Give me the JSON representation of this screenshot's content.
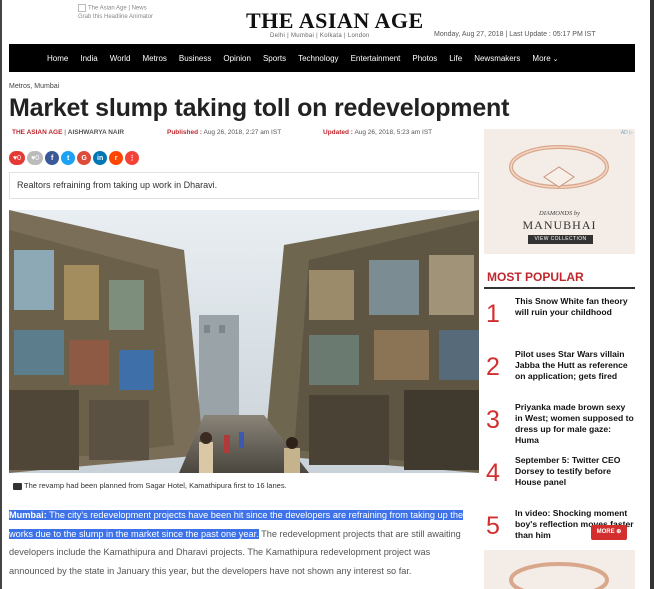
{
  "header": {
    "ad_thumb_text": "The Asian Age | News",
    "ad_thumb_sub": "Grab this Headline Animator",
    "logo": "THE ASIAN AGE",
    "logo_sub": "Delhi | Mumbai | Kolkata | London",
    "date": "Monday, Aug 27, 2018 | Last Update : 05:17 PM IST"
  },
  "nav": {
    "items": [
      "Home",
      "India",
      "World",
      "Metros",
      "Business",
      "Opinion",
      "Sports",
      "Technology",
      "Entertainment",
      "Photos",
      "Life",
      "Newsmakers",
      "More"
    ]
  },
  "article": {
    "breadcrumb": "Metros, Mumbai",
    "title": "Market slump taking toll on redevelopment",
    "source": "THE ASIAN AGE",
    "author": "AISHWARYA NAIR",
    "published_label": "Published :",
    "published": "Aug 26, 2018, 2:27 am IST",
    "updated_label": "Updated :",
    "updated": "Aug 26, 2018, 5:23 am IST",
    "likes": "0",
    "dislikes": "0",
    "subheading": "Realtors refraining from taking up work in Dharavi.",
    "caption": "The revamp had been planned from Sagar Hotel, Kamathipura first to 16 lanes.",
    "lead": "Mumbai:",
    "highlighted": " The city's redevelopment projects have been hit since the developers are refraining from taking up the works due to the slump in the market since the past one year.",
    "rest": " The redevelopment projects that are still awaiting developers include the Kamathipura and Dharavi projects. The Kamathipura redevelopment project was announced by the state in January this year, but the developers have not shown any interest so far."
  },
  "sidebar": {
    "ad": {
      "adchoices": "AD ▷",
      "line1": "DIAMONDS by",
      "line2": "MANUBHAI",
      "cta": "VIEW COLLECTION"
    },
    "most_popular_title": "MOST POPULAR",
    "items": [
      {
        "num": "1",
        "text": "This Snow White fan theory will ruin your childhood"
      },
      {
        "num": "2",
        "text": "Pilot uses Star Wars villain Jabba the Hutt as reference on application; gets fired"
      },
      {
        "num": "3",
        "text": "Priyanka made brown sexy in West; women supposed to dress up for male gaze: Huma"
      },
      {
        "num": "4",
        "text": "September 5: Twitter CEO Dorsey to testify before House panel"
      },
      {
        "num": "5",
        "text": "In video: Shocking moment boy's reflection moves faster than him"
      }
    ],
    "more_label": "MORE ⊕"
  },
  "colors": {
    "brand_red": "#c0272d",
    "nav_bg": "#000000",
    "highlight": "#3d72e8"
  }
}
